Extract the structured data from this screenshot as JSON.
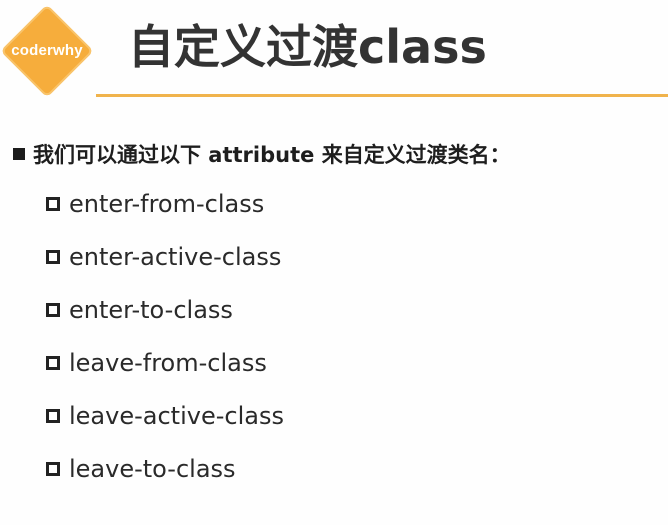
{
  "logo": {
    "text": "coderwhy"
  },
  "title": "自定义过渡class",
  "main_point": "我们可以通过以下 attribute 来自定义过渡类名：",
  "items": [
    "enter-from-class",
    "enter-active-class",
    "enter-to-class",
    "leave-from-class",
    "leave-active-class",
    "leave-to-class"
  ],
  "colors": {
    "accent": "#f6ad3c",
    "rule": "#f0b34c",
    "title_text": "#333333",
    "body_text": "#1e1e1e"
  }
}
